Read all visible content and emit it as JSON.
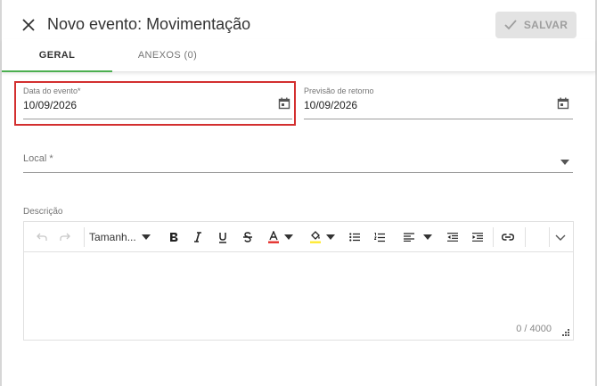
{
  "header": {
    "title": "Novo evento: Movimentação",
    "save_label": "SALVAR"
  },
  "tabs": [
    {
      "label": "GERAL",
      "active": true
    },
    {
      "label": "ANEXOS (0)",
      "active": false
    }
  ],
  "fields": {
    "event_date": {
      "label": "Data do evento*",
      "value": "10/09/2026"
    },
    "return_date": {
      "label": "Previsão de retorno",
      "value": "10/09/2026"
    },
    "location": {
      "label": "Local *",
      "value": ""
    },
    "description": {
      "label": "Descrição"
    }
  },
  "editor": {
    "font_size_label": "Tamanh...",
    "counter": "0 / 4000"
  },
  "colors": {
    "accent": "#4caf50",
    "highlight": "#d32f2f",
    "text_color_bar": "#e53935",
    "highlight_color_bar": "#ffeb3b"
  },
  "icons": [
    "close-icon",
    "check-icon",
    "calendar-icon",
    "dropdown-arrow-icon",
    "undo-icon",
    "redo-icon",
    "bold-icon",
    "italic-icon",
    "underline-icon",
    "strikethrough-icon",
    "text-color-icon",
    "highlight-color-icon",
    "bullet-list-icon",
    "numbered-list-icon",
    "align-left-icon",
    "outdent-icon",
    "indent-icon",
    "link-icon",
    "chevron-down-icon",
    "resize-handle-icon"
  ]
}
